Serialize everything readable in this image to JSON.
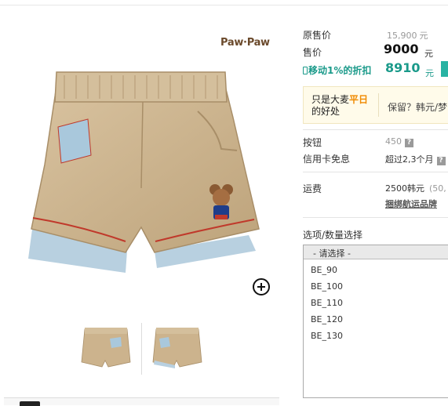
{
  "brand": "Paw·Paw",
  "price": {
    "original_label": "原售价",
    "original_value": "15,900",
    "original_unit": "元",
    "sale_label": "售价",
    "sale_value": "9000",
    "sale_unit": "元",
    "mobile_label": "移动1%的折扣",
    "mobile_value": "8910",
    "mobile_unit": "元"
  },
  "amazing": {
    "text_prefix": "只是大麦",
    "highlight": "平日",
    "text_suffix": "的好处",
    "right_text": "保留？韩元/梦"
  },
  "points": {
    "label": "按钮",
    "value": "450",
    "help": "?"
  },
  "card": {
    "label": "信用卡免息",
    "value": "超过2,3个月",
    "help": "?"
  },
  "shipping": {
    "label": "运费",
    "value": "2500韩元",
    "extra": "(50,",
    "link": "捆绑航运品牌"
  },
  "options": {
    "title": "选项/数量选择",
    "placeholder": "- 请选择 -",
    "items": [
      "BE_90",
      "BE_100",
      "BE_110",
      "BE_120",
      "BE_130"
    ]
  },
  "icons": {
    "zoom": "zoom-in-icon",
    "mobile": "mobile-phone-icon",
    "help": "help-icon"
  },
  "colors": {
    "teal": "#1a9a8a",
    "orange": "#f08a00",
    "khaki": "#cdb48f"
  }
}
